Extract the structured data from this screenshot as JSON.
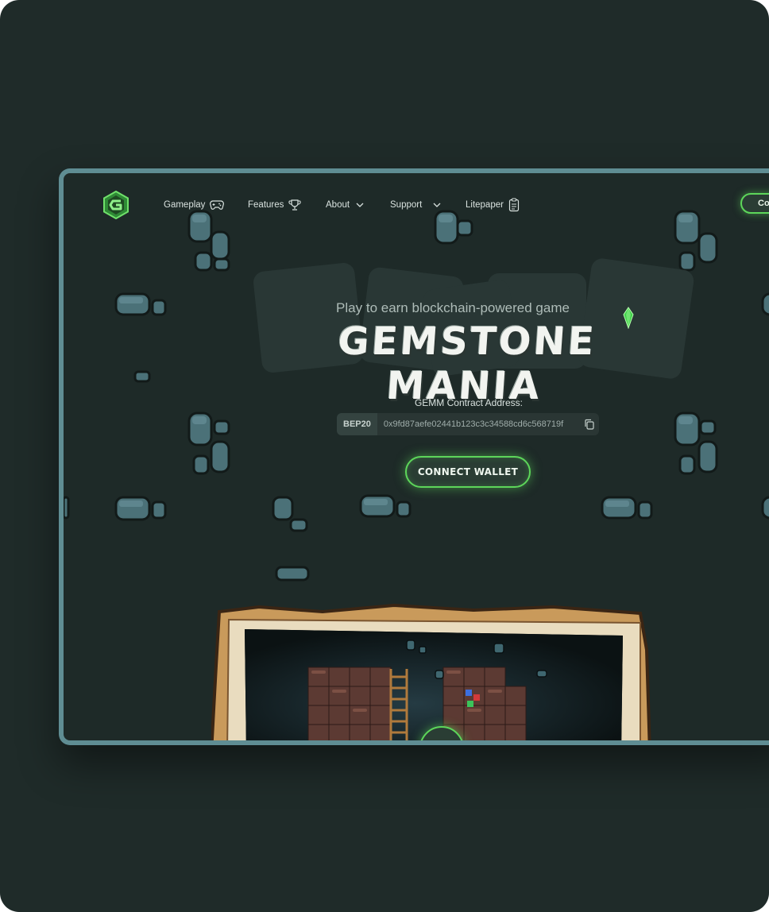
{
  "nav": {
    "items": [
      {
        "label": "Gameplay",
        "icon": "gamepad-icon"
      },
      {
        "label": "Features",
        "icon": "trophy-icon"
      },
      {
        "label": "About",
        "icon": "chevron-down-icon"
      },
      {
        "label": "Support",
        "icon": "chevron-down-icon"
      },
      {
        "label": "Litepaper",
        "icon": "document-icon"
      }
    ],
    "cta_label": "Connect Wallet"
  },
  "hero": {
    "subtitle": "Play to earn blockchain-powered game",
    "title": "GEMSTONE MANIA"
  },
  "contract": {
    "label": "GEMM Contract Address:",
    "chain": "BEP20",
    "address": "0x9fd87aefe02441b123c3c34588cd6c568719f"
  },
  "connect_button": "CONNECT WALLET",
  "colors": {
    "background": "#1e2a28",
    "accent": "#5dd65a",
    "frame": "#5f8d93",
    "wood": "#c99a5b"
  }
}
